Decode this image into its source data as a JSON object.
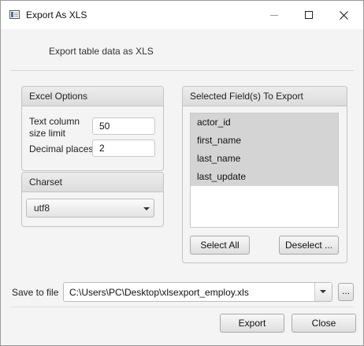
{
  "window": {
    "title": "Export As XLS",
    "minimize_icon": "minimize-icon",
    "maximize_icon": "maximize-icon",
    "close_icon": "close-icon"
  },
  "header": {
    "description": "Export table data as XLS"
  },
  "excel_options": {
    "title": "Excel Options",
    "text_limit_label_line1": "Text column",
    "text_limit_label_line2": "size limit",
    "text_limit_value": "50",
    "decimal_label": "Decimal places",
    "decimal_value": "2"
  },
  "charset": {
    "title": "Charset",
    "selected": "utf8",
    "dropdown_icon": "chevron-down-icon"
  },
  "fields": {
    "title": "Selected Field(s) To Export",
    "items": [
      "actor_id",
      "first_name",
      "last_name",
      "last_update"
    ],
    "select_all_label": "Select All",
    "deselect_label": "Deselect ..."
  },
  "save": {
    "label": "Save to file",
    "path": "C:\\Users\\PC\\Desktop\\xlsexport_employ.xls",
    "browse_label": "...",
    "dropdown_icon": "chevron-down-icon"
  },
  "actions": {
    "export_label": "Export",
    "close_label": "Close"
  }
}
